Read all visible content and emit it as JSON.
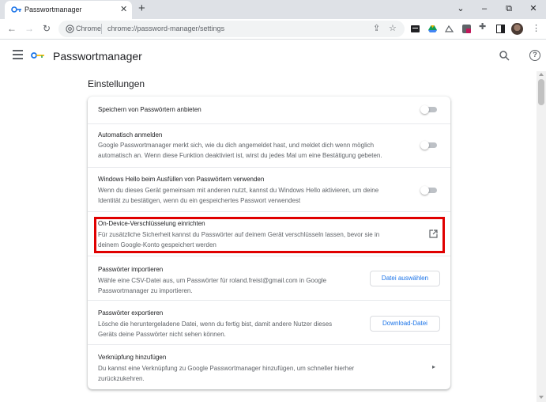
{
  "browser": {
    "tab_title": "Passwortmanager",
    "tab_close": "✕",
    "new_tab": "+",
    "window_controls": {
      "dropdown": "⌄",
      "minimize": "–",
      "maximize": "⧉",
      "close": "✕"
    },
    "omnibox": {
      "scheme": "Chrome",
      "url": "chrome://password-manager/settings"
    }
  },
  "app": {
    "title": "Passwortmanager",
    "section_title": "Einstellungen"
  },
  "settings": [
    {
      "title": "Speichern von Passwörtern anbieten",
      "desc": [],
      "control": "toggle",
      "toggle_on": false
    },
    {
      "title": "Automatisch anmelden",
      "desc": [
        "Google Passwortmanager merkt sich, wie du dich angemeldet hast, und meldet dich wenn möglich",
        "automatisch an. Wenn diese Funktion deaktiviert ist, wirst du jedes Mal um eine Bestätigung gebeten."
      ],
      "control": "toggle",
      "toggle_on": false
    },
    {
      "title": "Windows Hello beim Ausfüllen von Passwörtern verwenden",
      "desc": [
        "Wenn du dieses Gerät gemeinsam mit anderen nutzt, kannst du Windows Hello aktivieren, um deine",
        "Identität zu bestätigen, wenn du ein gespeichertes Passwort verwendest"
      ],
      "control": "toggle",
      "toggle_on": false
    },
    {
      "title": "On-Device-Verschlüsselung einrichten",
      "desc": [
        "Für zusätzliche Sicherheit kannst du Passwörter auf deinem Gerät verschlüsseln lassen, bevor sie in",
        "deinem Google-Konto gespeichert werden"
      ],
      "control": "external-link"
    },
    {
      "title": "Passwörter importieren",
      "desc": [
        "Wähle eine CSV-Datei aus, um Passwörter für roland.freist@gmail.com in Google",
        "Passwortmanager zu importieren."
      ],
      "control": "button",
      "button_label": "Datei auswählen"
    },
    {
      "title": "Passwörter exportieren",
      "desc": [
        "Lösche die heruntergeladene Datei, wenn du fertig bist, damit andere Nutzer dieses",
        "Geräts deine Passwörter nicht sehen können."
      ],
      "control": "button",
      "button_label": "Download-Datei"
    },
    {
      "title": "Verknüpfung hinzufügen",
      "desc": [
        "Du kannst eine Verknüpfung zu Google Passwortmanager hinzufügen, um schneller hierher",
        "zurückzukehren."
      ],
      "control": "chevron"
    }
  ],
  "colors": {
    "accent": "#1a73e8",
    "highlight": "#e00000"
  }
}
